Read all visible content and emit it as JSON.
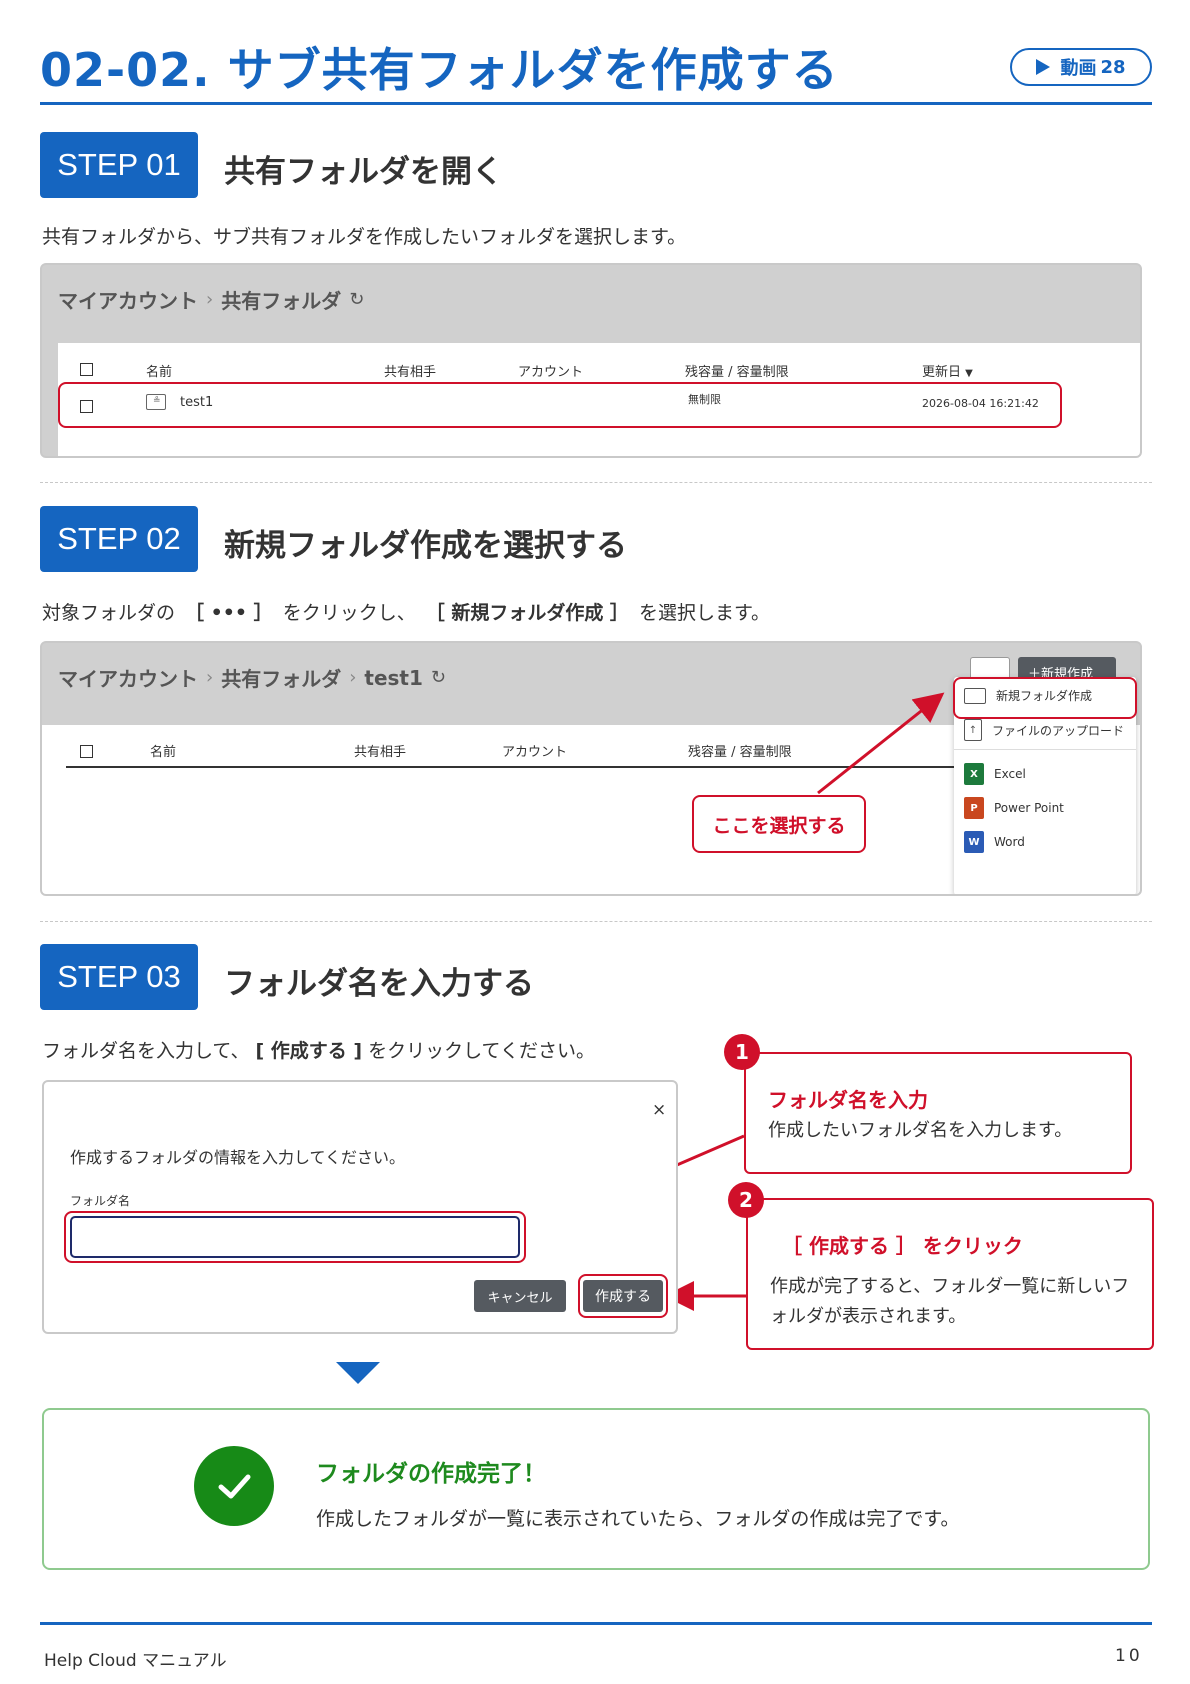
{
  "header": {
    "title": "02-02. サブ共有フォルダを作成する",
    "video_label": "動画",
    "video_number": "28"
  },
  "step1": {
    "badge": "STEP 01",
    "title": "共有フォルダを開く",
    "description": "共有フォルダから、サブ共有フォルダを作成したいフォルダを選択します。",
    "screenshot": {
      "breadcrumb": [
        "マイアカウント",
        "共有フォルダ"
      ],
      "columns": [
        "名前",
        "共有相手",
        "アカウント",
        "残容量 / 容量制限",
        "更新日"
      ],
      "row": {
        "name": "test1",
        "capacity": "無制限",
        "updated": "2026-08-04 16:21:42"
      }
    }
  },
  "step2": {
    "badge": "STEP 02",
    "title": "新規フォルダ作成を選択する",
    "description_pre": "対象フォルダの",
    "description_dots": "［ ••• ］",
    "description_mid": "をクリックし、",
    "description_bold": "［ 新規フォルダ作成 ］",
    "description_post": "を選択します。",
    "screenshot": {
      "breadcrumb": [
        "マイアカウント",
        "共有フォルダ",
        "test1"
      ],
      "columns": [
        "名前",
        "共有相手",
        "アカウント",
        "残容量 / 容量制限"
      ],
      "top_button": "＋新規作成",
      "menu": [
        "新規フォルダ作成",
        "ファイルのアップロード",
        "Excel",
        "Power Point",
        "Word"
      ],
      "callout": "ここを選択する"
    }
  },
  "step3": {
    "badge": "STEP 03",
    "title": "フォルダ名を入力する",
    "description_pre": "フォルダ名を入力して、",
    "description_bold": "[ 作成する ]",
    "description_post": "をクリックしてください。",
    "dialog": {
      "close": "×",
      "message": "作成するフォルダの情報を入力してください。",
      "field_label": "フォルダ名",
      "field_value": "",
      "cancel": "キャンセル",
      "create": "作成する"
    },
    "notes": [
      {
        "number": "1",
        "title": "フォルダ名を入力",
        "body": "作成したいフォルダ名を入力します。"
      },
      {
        "number": "2",
        "title": "［ 作成する ］ をクリック",
        "body": "作成が完了すると、フォルダ一覧に新しいフォルダが表示されます。"
      }
    ]
  },
  "done": {
    "title": "フォルダの作成完了！",
    "body": "作成したフォルダが一覧に表示されていたら、フォルダの作成は完了です。"
  },
  "footer": {
    "manual": "Help Cloud マニュアル",
    "page": "10"
  },
  "colors": {
    "brand": "#1565c0",
    "alert": "#d0102a",
    "success": "#178a17"
  }
}
